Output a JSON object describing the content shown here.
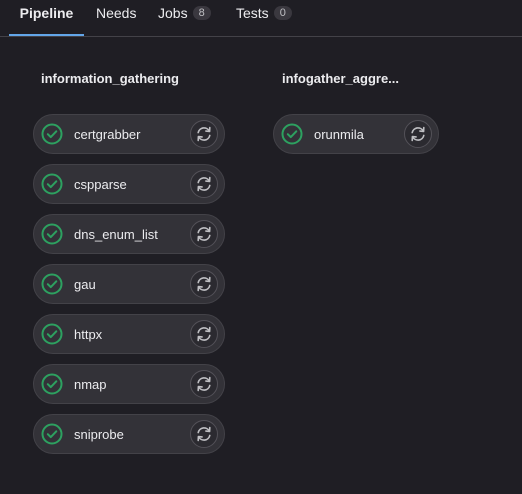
{
  "tabs": [
    {
      "label": "Pipeline",
      "active": true
    },
    {
      "label": "Needs"
    },
    {
      "label": "Jobs",
      "count": "8"
    },
    {
      "label": "Tests",
      "count": "0"
    }
  ],
  "stages": [
    {
      "title": "information_gathering",
      "jobs": [
        {
          "name": "certgrabber",
          "status": "passed"
        },
        {
          "name": "cspparse",
          "status": "passed"
        },
        {
          "name": "dns_enum_list",
          "status": "passed"
        },
        {
          "name": "gau",
          "status": "passed"
        },
        {
          "name": "httpx",
          "status": "passed"
        },
        {
          "name": "nmap",
          "status": "passed"
        },
        {
          "name": "sniprobe",
          "status": "passed"
        }
      ]
    },
    {
      "title": "infogather_aggre...",
      "jobs": [
        {
          "name": "orunmila",
          "status": "passed"
        }
      ]
    }
  ],
  "colors": {
    "success": "#2da160",
    "active_tab": "#63a6e9"
  },
  "icons": {
    "status": "check-circle-icon",
    "retry": "retry-icon"
  }
}
